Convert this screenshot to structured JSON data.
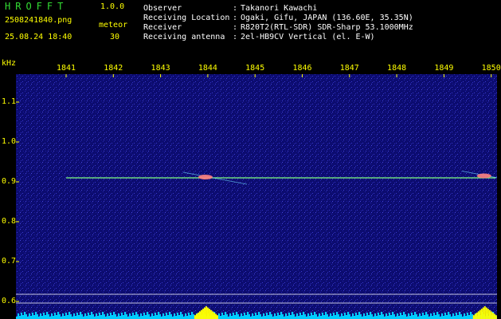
{
  "header": {
    "app_name": "HROFFT",
    "version": "1.0.0",
    "filename": "2508241840.png",
    "datetime": "25.08.24 18:40",
    "meteor_label": "meteor",
    "meteor_count": "30"
  },
  "info": [
    {
      "label": "Observer",
      "value": "Takanori Kawachi"
    },
    {
      "label": "Receiving Location",
      "value": "Ogaki, Gifu, JAPAN (136.60E, 35.35N)"
    },
    {
      "label": "Receiver",
      "value": "R820T2(RTL-SDR) SDR-Sharp 53.1000MHz"
    },
    {
      "label": "Receiving antenna",
      "value": "2el-HB9CV Vertical (el. E-W)"
    }
  ],
  "colors": {
    "label_text": "#ffff00",
    "title_text": "#33dd33",
    "info_text": "#ffffff",
    "background": "#000010",
    "plot_noise": "#1a1a9a",
    "signal_line": "#7fff7f",
    "meteor_echo": "#ff8080",
    "power_bar": "#00ccff",
    "power_peak": "#ffff00"
  },
  "chart_data": {
    "type": "heatmap",
    "xlabel": "",
    "ylabel": "kHz",
    "x_ticks": [
      "1841",
      "1842",
      "1843",
      "1844",
      "1845",
      "1846",
      "1847",
      "1848",
      "1849",
      "1850"
    ],
    "y_ticks": [
      "1.1",
      "1.0",
      "0.9",
      "0.8",
      "0.7",
      "0.6"
    ],
    "xlim": [
      1840.9,
      1850.1
    ],
    "ylim": [
      0.6,
      1.16
    ],
    "carrier_line": {
      "from_minute": 1841.0,
      "to_minute": 1850.1,
      "khz": 0.91
    },
    "meteor_echoes": [
      {
        "minute": 1843.95,
        "khz": 0.912
      },
      {
        "minute": 1849.85,
        "khz": 0.915
      }
    ],
    "power_peaks_minutes": [
      1843.95,
      1849.85
    ]
  }
}
